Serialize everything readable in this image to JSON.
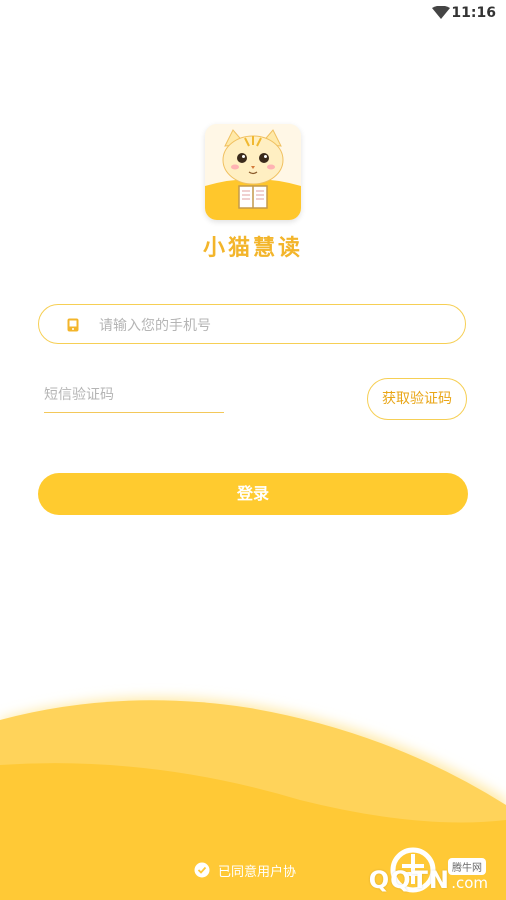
{
  "status_bar": {
    "time": "11:16",
    "icons": [
      "wifi-icon"
    ]
  },
  "app": {
    "name": "小猫慧读",
    "logo_icon": "cat-reading-logo"
  },
  "login": {
    "phone_placeholder": "请输入您的手机号",
    "phone_icon": "phone-icon",
    "sms_placeholder": "短信验证码",
    "get_code_label": "获取验证码",
    "login_label": "登录"
  },
  "agreement": {
    "text": "已同意用户协",
    "icon": "check-circle-icon"
  },
  "watermark": {
    "brand": "QQTN",
    "domain": ".com",
    "tag": "腾牛网"
  },
  "colors": {
    "accent": "#ffcb2f",
    "accent_border": "#f6cf55",
    "accent_text": "#e9a617",
    "wave": "#ffc936"
  }
}
